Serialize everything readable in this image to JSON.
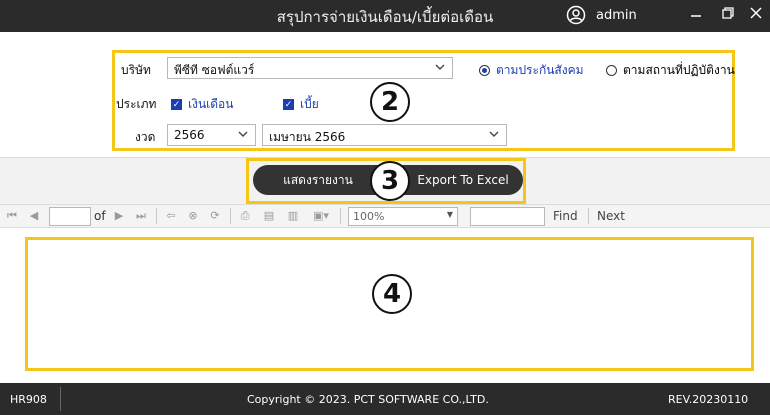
{
  "window": {
    "title": "สรุปการจ่ายเงินเดือน/เบี้ยต่อเดือน",
    "user_name": "admin",
    "icons": [
      "user-circle-icon",
      "minimize-icon",
      "maximize-icon",
      "close-icon"
    ]
  },
  "form": {
    "company_label": "บริษัท",
    "company_value": "พีซีที ซอฟต์แวร์",
    "radio_social": "ตามประกันสังคม",
    "radio_workplace": "ตามสถานที่ปฏิบัติงาน",
    "type_label": "ประเภท",
    "check_salary": "เงินเดือน",
    "check_allowance": "เบี้ย",
    "period_label": "งวด",
    "year_value": "2566",
    "month_value": "เมษายน 2566",
    "selected_radio": "social"
  },
  "actions": {
    "show_report": "แสดงรายงาน",
    "export_excel": "Export To Excel"
  },
  "report_toolbar": {
    "page_of": "of",
    "zoom": "100%",
    "find": "Find",
    "next": "Next"
  },
  "callouts": [
    "2",
    "3",
    "4"
  ],
  "status": {
    "code": "HR908",
    "copyright": "Copyright © 2023. PCT SOFTWARE CO.,LTD.",
    "revision": "REV.20230110"
  },
  "colors": {
    "titlebar": "#2b2b2b",
    "highlight": "#f5c518",
    "accent": "#1a3fb0",
    "button": "#333333"
  }
}
